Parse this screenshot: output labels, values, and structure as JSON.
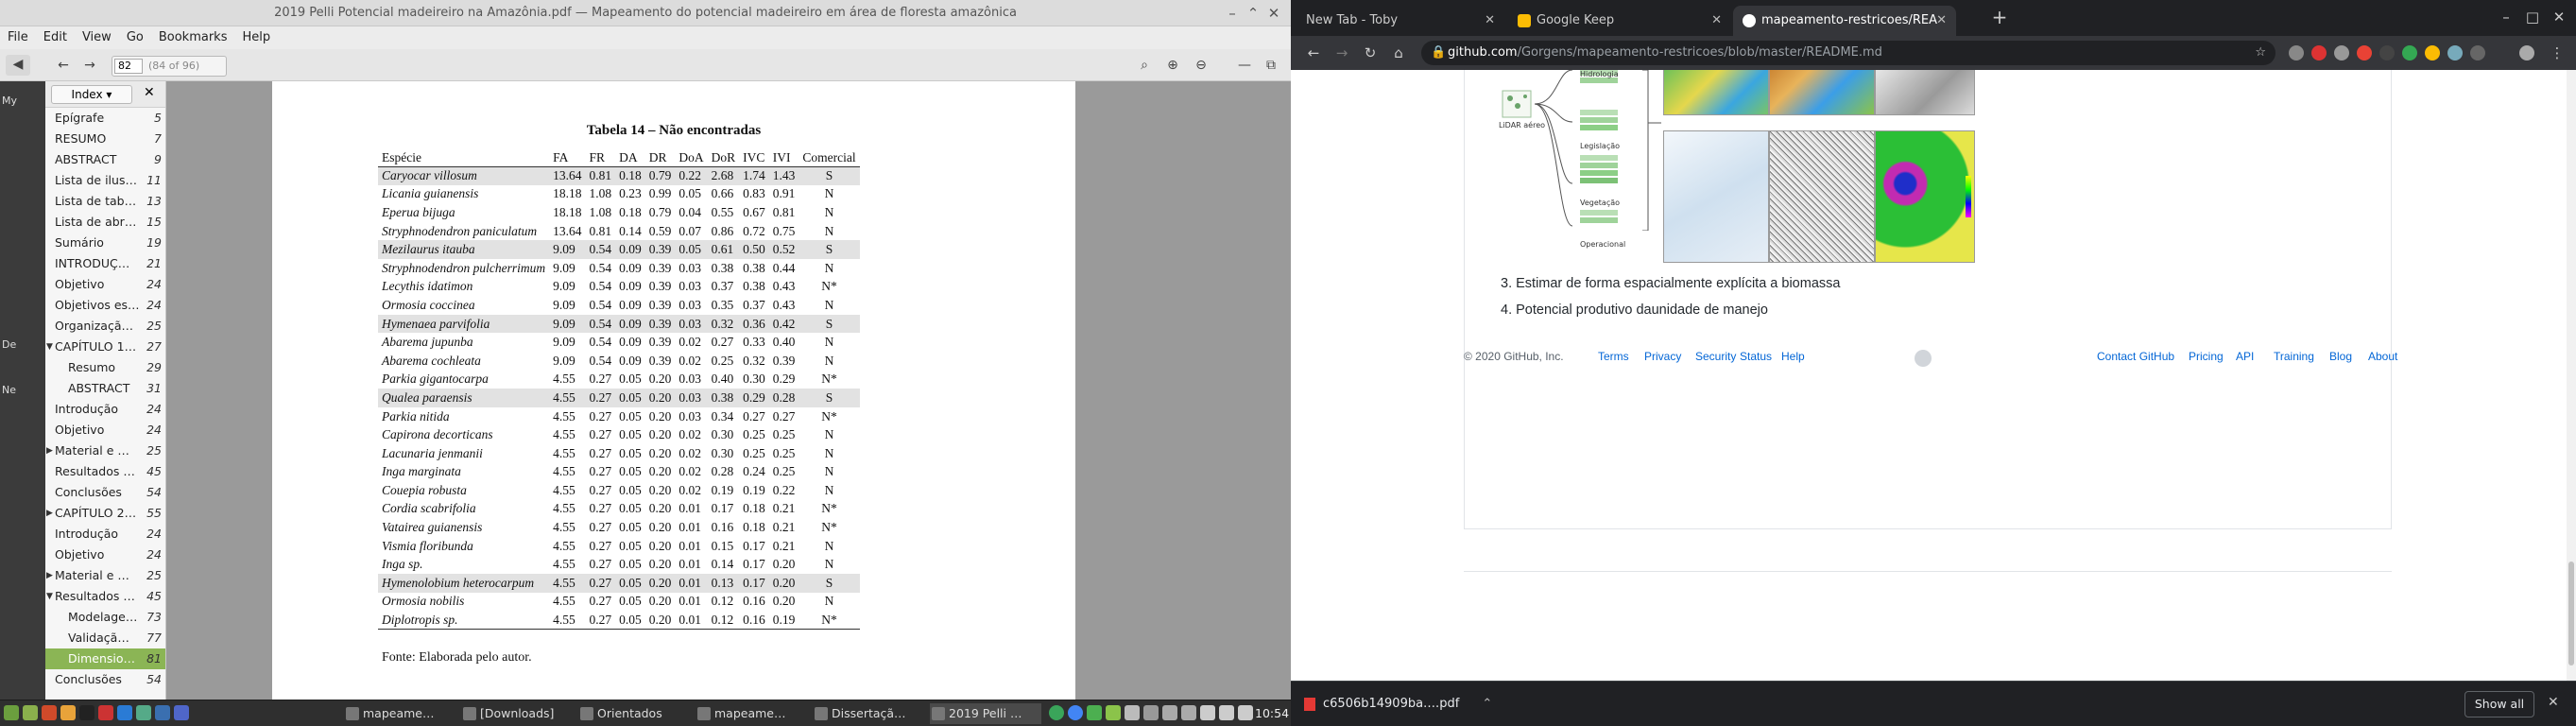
{
  "viewer": {
    "window_title": "2019 Pelli Potencial madeireiro na Amazônia.pdf — Mapeamento do potencial madeireiro em área de floresta amazônica",
    "menu": [
      "File",
      "Edit",
      "View",
      "Go",
      "Bookmarks",
      "Help"
    ],
    "page_number": "82",
    "page_of": "(84 of 96)",
    "sidebar_mode": "Index",
    "toc": [
      {
        "label": "Epígrafe",
        "page": "5",
        "indent": 1
      },
      {
        "label": "RESUMO",
        "page": "7",
        "indent": 1
      },
      {
        "label": "ABSTRACT",
        "page": "9",
        "indent": 1
      },
      {
        "label": "Lista de ilus…",
        "page": "11",
        "indent": 1
      },
      {
        "label": "Lista de tab…",
        "page": "13",
        "indent": 1
      },
      {
        "label": "Lista de abr…",
        "page": "15",
        "indent": 1
      },
      {
        "label": "Sumário",
        "page": "19",
        "indent": 1
      },
      {
        "label": "INTRODUÇ…",
        "page": "21",
        "indent": 1
      },
      {
        "label": "Objetivo",
        "page": "24",
        "indent": 1
      },
      {
        "label": "Objetivos es…",
        "page": "24",
        "indent": 1
      },
      {
        "label": "Organizaçã…",
        "page": "25",
        "indent": 1
      },
      {
        "label": "CAPÍTULO 1…",
        "page": "27",
        "indent": 1,
        "arrow": "▼"
      },
      {
        "label": "Resumo",
        "page": "29",
        "indent": 2
      },
      {
        "label": "ABSTRACT",
        "page": "31",
        "indent": 2
      },
      {
        "label": "Introdução",
        "page": "24",
        "indent": 1
      },
      {
        "label": "Objetivo",
        "page": "24",
        "indent": 1
      },
      {
        "label": "Material e …",
        "page": "25",
        "indent": 1,
        "arrow": "▶"
      },
      {
        "label": "Resultados …",
        "page": "45",
        "indent": 1
      },
      {
        "label": "Conclusões",
        "page": "54",
        "indent": 1
      },
      {
        "label": "CAPÍTULO 2…",
        "page": "55",
        "indent": 1,
        "arrow": "▶"
      },
      {
        "label": "Introdução",
        "page": "24",
        "indent": 1
      },
      {
        "label": "Objetivo",
        "page": "24",
        "indent": 1
      },
      {
        "label": "Material e …",
        "page": "25",
        "indent": 1,
        "arrow": "▶"
      },
      {
        "label": "Resultados …",
        "page": "45",
        "indent": 1,
        "arrow": "▼"
      },
      {
        "label": "Modelage…",
        "page": "73",
        "indent": 2
      },
      {
        "label": "Validaçã…",
        "page": "77",
        "indent": 2
      },
      {
        "label": "Dimensio…",
        "page": "81",
        "indent": 2,
        "active": true
      },
      {
        "label": "Conclusões",
        "page": "54",
        "indent": 1
      }
    ],
    "left_strip_labels": [
      "My",
      "De",
      "Ne"
    ],
    "table_title": "Tabela 14 – Não encontradas",
    "columns": [
      "Espécie",
      "FA",
      "FR",
      "DA",
      "DR",
      "DoA",
      "DoR",
      "IVC",
      "IVI",
      "Comercial"
    ],
    "rows": [
      {
        "sp": "Caryocar villosum",
        "v": [
          "13.64",
          "0.81",
          "0.18",
          "0.79",
          "0.22",
          "2.68",
          "1.74",
          "1.43"
        ],
        "c": "S",
        "hl": true
      },
      {
        "sp": "Licania guianensis",
        "v": [
          "18.18",
          "1.08",
          "0.23",
          "0.99",
          "0.05",
          "0.66",
          "0.83",
          "0.91"
        ],
        "c": "N"
      },
      {
        "sp": "Eperua bijuga",
        "v": [
          "18.18",
          "1.08",
          "0.18",
          "0.79",
          "0.04",
          "0.55",
          "0.67",
          "0.81"
        ],
        "c": "N"
      },
      {
        "sp": "Stryphnodendron paniculatum",
        "v": [
          "13.64",
          "0.81",
          "0.14",
          "0.59",
          "0.07",
          "0.86",
          "0.72",
          "0.75"
        ],
        "c": "N"
      },
      {
        "sp": "Mezilaurus itauba",
        "v": [
          "9.09",
          "0.54",
          "0.09",
          "0.39",
          "0.05",
          "0.61",
          "0.50",
          "0.52"
        ],
        "c": "S",
        "hl": true
      },
      {
        "sp": "Stryphnodendron pulcherrimum",
        "v": [
          "9.09",
          "0.54",
          "0.09",
          "0.39",
          "0.03",
          "0.38",
          "0.38",
          "0.44"
        ],
        "c": "N"
      },
      {
        "sp": "Lecythis idatimon",
        "v": [
          "9.09",
          "0.54",
          "0.09",
          "0.39",
          "0.03",
          "0.37",
          "0.38",
          "0.43"
        ],
        "c": "N*"
      },
      {
        "sp": "Ormosia coccinea",
        "v": [
          "9.09",
          "0.54",
          "0.09",
          "0.39",
          "0.03",
          "0.35",
          "0.37",
          "0.43"
        ],
        "c": "N"
      },
      {
        "sp": "Hymenaea parvifolia",
        "v": [
          "9.09",
          "0.54",
          "0.09",
          "0.39",
          "0.03",
          "0.32",
          "0.36",
          "0.42"
        ],
        "c": "S",
        "hl": true
      },
      {
        "sp": "Abarema jupunba",
        "v": [
          "9.09",
          "0.54",
          "0.09",
          "0.39",
          "0.02",
          "0.27",
          "0.33",
          "0.40"
        ],
        "c": "N"
      },
      {
        "sp": "Abarema cochleata",
        "v": [
          "9.09",
          "0.54",
          "0.09",
          "0.39",
          "0.02",
          "0.25",
          "0.32",
          "0.39"
        ],
        "c": "N"
      },
      {
        "sp": "Parkia gigantocarpa",
        "v": [
          "4.55",
          "0.27",
          "0.05",
          "0.20",
          "0.03",
          "0.40",
          "0.30",
          "0.29"
        ],
        "c": "N*"
      },
      {
        "sp": "Qualea paraensis",
        "v": [
          "4.55",
          "0.27",
          "0.05",
          "0.20",
          "0.03",
          "0.38",
          "0.29",
          "0.28"
        ],
        "c": "S",
        "hl": true
      },
      {
        "sp": "Parkia nitida",
        "v": [
          "4.55",
          "0.27",
          "0.05",
          "0.20",
          "0.03",
          "0.34",
          "0.27",
          "0.27"
        ],
        "c": "N*"
      },
      {
        "sp": "Capirona decorticans",
        "v": [
          "4.55",
          "0.27",
          "0.05",
          "0.20",
          "0.02",
          "0.30",
          "0.25",
          "0.25"
        ],
        "c": "N"
      },
      {
        "sp": "Lacunaria jenmanii",
        "v": [
          "4.55",
          "0.27",
          "0.05",
          "0.20",
          "0.02",
          "0.30",
          "0.25",
          "0.25"
        ],
        "c": "N"
      },
      {
        "sp": "Inga marginata",
        "v": [
          "4.55",
          "0.27",
          "0.05",
          "0.20",
          "0.02",
          "0.28",
          "0.24",
          "0.25"
        ],
        "c": "N"
      },
      {
        "sp": "Couepia robusta",
        "v": [
          "4.55",
          "0.27",
          "0.05",
          "0.20",
          "0.02",
          "0.19",
          "0.19",
          "0.22"
        ],
        "c": "N"
      },
      {
        "sp": "Cordia scabrifolia",
        "v": [
          "4.55",
          "0.27",
          "0.05",
          "0.20",
          "0.01",
          "0.17",
          "0.18",
          "0.21"
        ],
        "c": "N*"
      },
      {
        "sp": "Vatairea guianensis",
        "v": [
          "4.55",
          "0.27",
          "0.05",
          "0.20",
          "0.01",
          "0.16",
          "0.18",
          "0.21"
        ],
        "c": "N*"
      },
      {
        "sp": "Vismia floribunda",
        "v": [
          "4.55",
          "0.27",
          "0.05",
          "0.20",
          "0.01",
          "0.15",
          "0.17",
          "0.21"
        ],
        "c": "N"
      },
      {
        "sp": "Inga sp.",
        "v": [
          "4.55",
          "0.27",
          "0.05",
          "0.20",
          "0.01",
          "0.14",
          "0.17",
          "0.20"
        ],
        "c": "N"
      },
      {
        "sp": "Hymenolobium heterocarpum",
        "v": [
          "4.55",
          "0.27",
          "0.05",
          "0.20",
          "0.01",
          "0.13",
          "0.17",
          "0.20"
        ],
        "c": "S",
        "hl": true
      },
      {
        "sp": "Ormosia nobilis",
        "v": [
          "4.55",
          "0.27",
          "0.05",
          "0.20",
          "0.01",
          "0.12",
          "0.16",
          "0.20"
        ],
        "c": "N"
      },
      {
        "sp": "Diplotropis sp.",
        "v": [
          "4.55",
          "0.27",
          "0.05",
          "0.20",
          "0.01",
          "0.12",
          "0.16",
          "0.19"
        ],
        "c": "N*"
      }
    ],
    "fonte": "Fonte: Elaborada pelo autor."
  },
  "taskbar": {
    "tasks": [
      {
        "label": "mapeame…"
      },
      {
        "label": "[Downloads]"
      },
      {
        "label": "Orientados"
      },
      {
        "label": "mapeame…"
      },
      {
        "label": "Dissertaçã…"
      },
      {
        "label": "2019 Pelli …",
        "active": true
      }
    ],
    "clock": "10:54"
  },
  "browser": {
    "tabs": [
      {
        "label": "New Tab - Toby",
        "fav_color": "#4285f4"
      },
      {
        "label": "Google Keep",
        "fav_color": "#fbbc04"
      },
      {
        "label": "mapeamento-restricoes/REA",
        "fav_color": "#ffffff",
        "active": true
      }
    ],
    "url_domain": "github.com",
    "url_path": "/Gorgens/mapeamento-restricoes/blob/master/README.md",
    "figure_labels": {
      "lidar": "LiDAR aéreo",
      "hidro": "Hidrologia",
      "legis": "Legislação",
      "veget": "Vegetação",
      "oper": "Operacional"
    },
    "list_items": [
      "3. Estimar de forma espacialmente explícita a biomassa",
      "4. Potencial produtivo daunidade de manejo"
    ],
    "footer": {
      "copyright": "© 2020 GitHub, Inc.",
      "left_links": [
        "Terms",
        "Privacy",
        "Security",
        "Status",
        "Help"
      ],
      "right_links": [
        "Contact GitHub",
        "Pricing",
        "API",
        "Training",
        "Blog",
        "About"
      ]
    },
    "download": {
      "filename": "c6506b14909ba….pdf",
      "show_all": "Show all"
    }
  },
  "colors": {
    "active_toc": "#8bb555",
    "link": "#0366d6"
  }
}
